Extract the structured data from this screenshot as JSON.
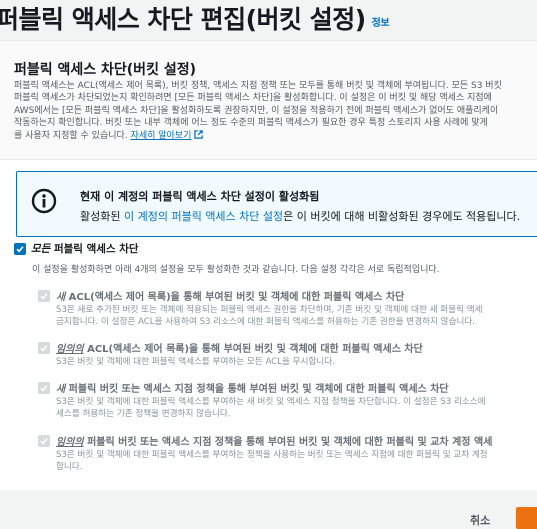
{
  "page": {
    "title": "퍼블릭 액세스 차단 편집(버킷 설정)",
    "info_link": "정보"
  },
  "panel": {
    "title": "퍼블릭 액세스 차단(버킷 설정)",
    "desc_lines": [
      "퍼블릭 액세스는 ACL(액세스 제어 목록), 버킷 정책, 액세스 지점 정책 또는 모두를 통해 버킷 및 객체에 부여됩니다. 모든 S3 버킷",
      "퍼블릭 액세스가 차단되었는지 확인하려면 [모든 퍼블릭 액세스 차단]을 활성화합니다. 이 설정은 이 버킷 및 해당 액세스 지점에",
      "AWS에서는 [모든 퍼블릭 액세스 차단]을 활성화하도록 권장하지만, 이 설정을 적용하기 전에 퍼블릭 액세스가 없어도 애플리케이",
      "작동하는지 확인합니다. 버킷 또는 내부 객체에 어느 정도 수준의 퍼블릭 액세스가 필요한 경우 특정 스토리지 사용 사례에 맞게"
    ],
    "desc_last": "를 사용자 지정할 수 있습니다.",
    "learn_more": "자세히 알아보기"
  },
  "alert": {
    "title": "현재 이 계정의 퍼블릭 액세스 차단 설정이 활성화됨",
    "body_prefix": "활성화된 ",
    "body_link": "이 계정의 퍼블릭 액세스 차단 설정",
    "body_suffix": "은 이 버킷에 대해 비활성화된 경우에도 적용됩니다."
  },
  "master": {
    "label_em": "모든",
    "label_rest": " 퍼블릭 액세스 차단",
    "desc": "이 설정을 활성화하면 아래 4개의 설정을 모두 활성화한 것과 같습니다. 다음 설정 각각은 서로 독립적입니다.",
    "checked": true
  },
  "subs": [
    {
      "em": "새",
      "title": " ACL(액세스 제어 목록)을 통해 부여된 버킷 및 객체에 대한 퍼블릭 액세스 차단",
      "lines": [
        "S3은 새로 추가된 버킷 또는 객체에 적용되는 퍼블릭 액세스 권한을 차단하며, 기존 버킷 및 객체에 대한 새 퍼블릭 액세",
        "금지합니다. 이 설정은 ACL을 사용하여 S3 리소스에 대한 퍼블릭 액세스를 허용하는 기존 권한을 변경하지 않습니다."
      ]
    },
    {
      "em": "임의의",
      "title": " ACL(액세스 제어 목록)을 통해 부여된 버킷 및 객체에 대한 퍼블릭 액세스 차단",
      "lines": [
        "S3은 버킷 및 객체에 대한 퍼블릭 액세스를 부여하는 모든 ACL을 무시합니다."
      ]
    },
    {
      "em": "새",
      "title": " 퍼블릭 버킷 또는 액세스 지점 정책을 통해 부여된 버킷 및 객체에 대한 퍼블릭 액세스 차단",
      "lines": [
        "S3은 버킷 및 객체에 대한 퍼블릭 액세스를 부여하는 새 버킷 및 액세스 지점 정책을 차단합니다. 이 설정은 S3 리소스에",
        "세스를 허용하는 기존 정책을 변경하지 않습니다."
      ]
    },
    {
      "em": "임의의",
      "title": " 퍼블릭 버킷 또는 액세스 지점 정책을 통해 부여된 버킷 및 객체에 대한 퍼블릭 및 교차 계정 액세",
      "lines": [
        "S3은 버킷 및 객체에 대한 퍼블릭 액세스를 부여하는 정책을 사용하는 버킷 또는 액세스 지점에 대한 퍼블릭 및 교차 계정",
        "합니다."
      ]
    }
  ],
  "footer": {
    "cancel": "취소"
  },
  "colors": {
    "link": "#0073bb",
    "primary": "#ec7211",
    "alert_bg": "#f1faff"
  }
}
